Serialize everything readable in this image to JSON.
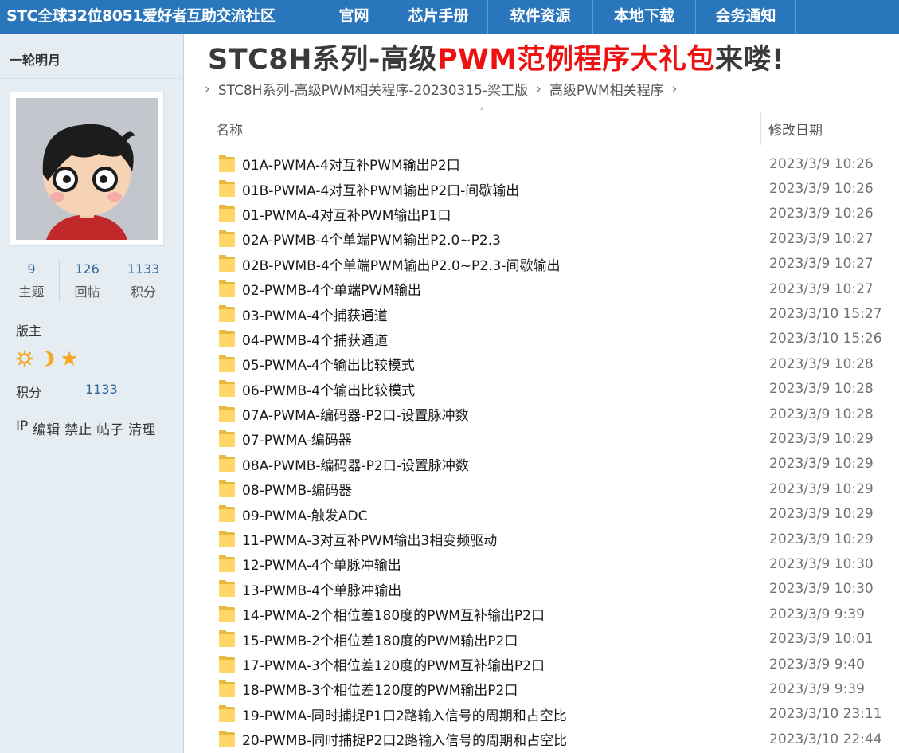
{
  "nav": {
    "brand": "STC全球32位8051爱好者互助交流社区",
    "items": [
      "官网",
      "芯片手册",
      "软件资源",
      "本地下载",
      "会务通知"
    ]
  },
  "sidebar": {
    "username": "一轮明月",
    "stats": [
      {
        "value": "9",
        "label": "主题"
      },
      {
        "value": "126",
        "label": "回帖"
      },
      {
        "value": "1133",
        "label": "积分"
      }
    ],
    "rank": "版主",
    "medal_icons": [
      "sun-icon",
      "moon-icon",
      "star-icon"
    ],
    "credit_label": "积分",
    "credit_value": "1133",
    "actions": [
      "IP",
      "编辑",
      "禁止",
      "帖子",
      "清理"
    ]
  },
  "post": {
    "title_part1": "STC8H系列-高级",
    "title_part2": "PWM范例程序大礼包",
    "title_part3": "来喽!",
    "breadcrumb": [
      "STC8H系列-高级PWM相关程序-20230315-梁工版",
      "高级PWM相关程序"
    ]
  },
  "file_list": {
    "col_name": "名称",
    "col_date": "修改日期",
    "rows": [
      {
        "name": "01A-PWMA-4对互补PWM输出P2口",
        "date": "2023/3/9 10:26"
      },
      {
        "name": "01B-PWMA-4对互补PWM输出P2口-间歇输出",
        "date": "2023/3/9 10:26"
      },
      {
        "name": "01-PWMA-4对互补PWM输出P1口",
        "date": "2023/3/9 10:26"
      },
      {
        "name": "02A-PWMB-4个单端PWM输出P2.0~P2.3",
        "date": "2023/3/9 10:27"
      },
      {
        "name": "02B-PWMB-4个单端PWM输出P2.0~P2.3-间歇输出",
        "date": "2023/3/9 10:27"
      },
      {
        "name": "02-PWMB-4个单端PWM输出",
        "date": "2023/3/9 10:27"
      },
      {
        "name": "03-PWMA-4个捕获通道",
        "date": "2023/3/10 15:27"
      },
      {
        "name": "04-PWMB-4个捕获通道",
        "date": "2023/3/10 15:26"
      },
      {
        "name": "05-PWMA-4个输出比较模式",
        "date": "2023/3/9 10:28"
      },
      {
        "name": "06-PWMB-4个输出比较模式",
        "date": "2023/3/9 10:28"
      },
      {
        "name": "07A-PWMA-编码器-P2口-设置脉冲数",
        "date": "2023/3/9 10:28"
      },
      {
        "name": "07-PWMA-编码器",
        "date": "2023/3/9 10:29"
      },
      {
        "name": "08A-PWMB-编码器-P2口-设置脉冲数",
        "date": "2023/3/9 10:29"
      },
      {
        "name": "08-PWMB-编码器",
        "date": "2023/3/9 10:29"
      },
      {
        "name": "09-PWMA-触发ADC",
        "date": "2023/3/9 10:29"
      },
      {
        "name": "11-PWMA-3对互补PWM输出3相变频驱动",
        "date": "2023/3/9 10:29"
      },
      {
        "name": "12-PWMA-4个单脉冲输出",
        "date": "2023/3/9 10:30"
      },
      {
        "name": "13-PWMB-4个单脉冲输出",
        "date": "2023/3/9 10:30"
      },
      {
        "name": "14-PWMA-2个相位差180度的PWM互补输出P2口",
        "date": "2023/3/9 9:39"
      },
      {
        "name": "15-PWMB-2个相位差180度的PWM输出P2口",
        "date": "2023/3/9 10:01"
      },
      {
        "name": "17-PWMA-3个相位差120度的PWM互补输出P2口",
        "date": "2023/3/9 9:40"
      },
      {
        "name": "18-PWMB-3个相位差120度的PWM输出P2口",
        "date": "2023/3/9 9:39"
      },
      {
        "name": "19-PWMA-同时捕捉P1口2路输入信号的周期和占空比",
        "date": "2023/3/10 23:11"
      },
      {
        "name": "20-PWMB-同时捕捉P2口2路输入信号的周期和占空比",
        "date": "2023/3/10 22:44"
      }
    ]
  }
}
